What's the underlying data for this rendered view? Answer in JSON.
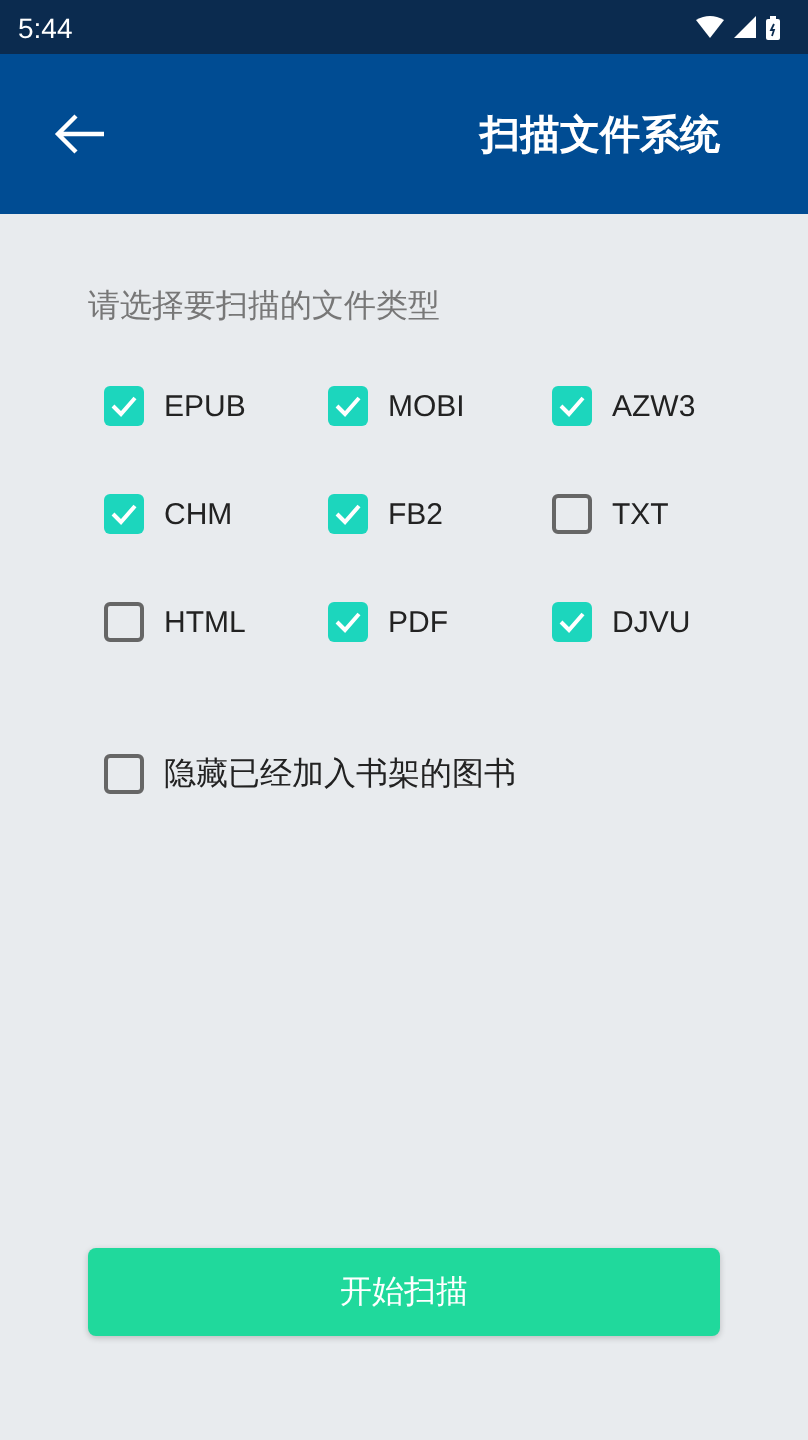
{
  "status_bar": {
    "time": "5:44"
  },
  "app_bar": {
    "title": "扫描文件系统"
  },
  "prompt": "请选择要扫描的文件类型",
  "file_types": [
    {
      "label": "EPUB",
      "checked": true
    },
    {
      "label": "MOBI",
      "checked": true
    },
    {
      "label": "AZW3",
      "checked": true
    },
    {
      "label": "CHM",
      "checked": true
    },
    {
      "label": "FB2",
      "checked": true
    },
    {
      "label": "TXT",
      "checked": false
    },
    {
      "label": "HTML",
      "checked": false
    },
    {
      "label": "PDF",
      "checked": true
    },
    {
      "label": "DJVU",
      "checked": true
    }
  ],
  "hide_option": {
    "label": "隐藏已经加入书架的图书",
    "checked": false
  },
  "start_button": "开始扫描"
}
